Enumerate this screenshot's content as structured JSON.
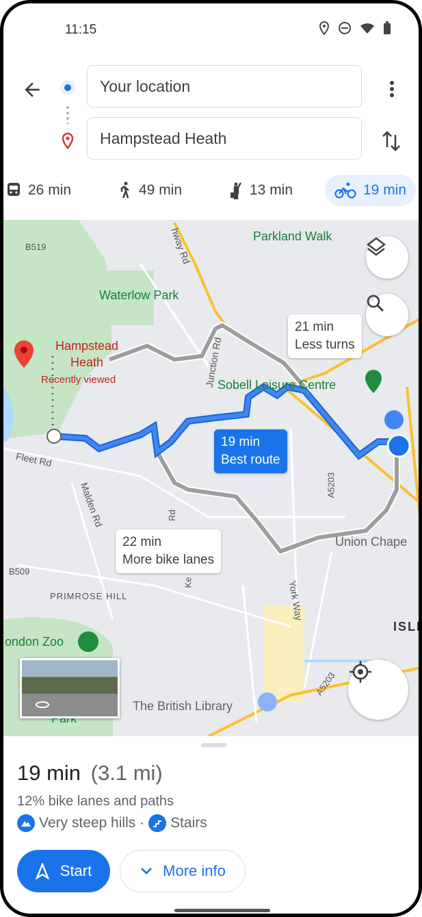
{
  "status_bar": {
    "time": "11:15",
    "icons": [
      "location-icon",
      "do-not-disturb-icon",
      "wifi-icon",
      "battery-icon"
    ]
  },
  "directions": {
    "origin": "Your location",
    "destination": "Hampstead Heath"
  },
  "modes": [
    {
      "icon": "train-icon",
      "label": "26 min",
      "active": false
    },
    {
      "icon": "walk-icon",
      "label": "49 min",
      "active": false
    },
    {
      "icon": "ride-hail-icon",
      "label": "13 min",
      "active": false
    },
    {
      "icon": "bike-icon",
      "label": "19 min",
      "active": true
    }
  ],
  "map": {
    "labels": {
      "parkland": "Parkland Walk",
      "waterlow": "Waterlow Park",
      "heath": "Hampstead Heath",
      "recent": "Recently viewed",
      "sobell": "Sobell Leisure Centre",
      "junction": "Junction Rd",
      "fleet": "Fleet Rd",
      "malden": "Malden Rd",
      "b519": "B519",
      "b509": "B509",
      "primrose": "PRIMROSE HILL",
      "zoo": "ondon Zoo",
      "library": "The British Library",
      "york": "York Way",
      "a5203a": "A5203",
      "a5203b": "A5203",
      "union": "Union Chape",
      "isli": "ISLI",
      "park": "Park",
      "archway": "hway Rd",
      "rd": "Rd",
      "ke": "Ke"
    },
    "routes": [
      {
        "time": "21 min",
        "note": "Less turns",
        "selected": false
      },
      {
        "time": "19 min",
        "note": "Best route",
        "selected": true
      },
      {
        "time": "22 min",
        "note": "More bike lanes",
        "selected": false
      }
    ],
    "colors": {
      "selected_route": "#1a73e8",
      "alt_route": "#9e9e9e",
      "park": "#c8e6c9",
      "water": "#aadaff",
      "major_road": "#fbc02d"
    }
  },
  "summary": {
    "time": "19 min",
    "distance": "(3.1 mi)",
    "bike_lanes": "12% bike lanes and paths",
    "warning1": "Very steep hills ·",
    "warning2": "Stairs"
  },
  "actions": {
    "start": "Start",
    "more_info": "More info"
  }
}
